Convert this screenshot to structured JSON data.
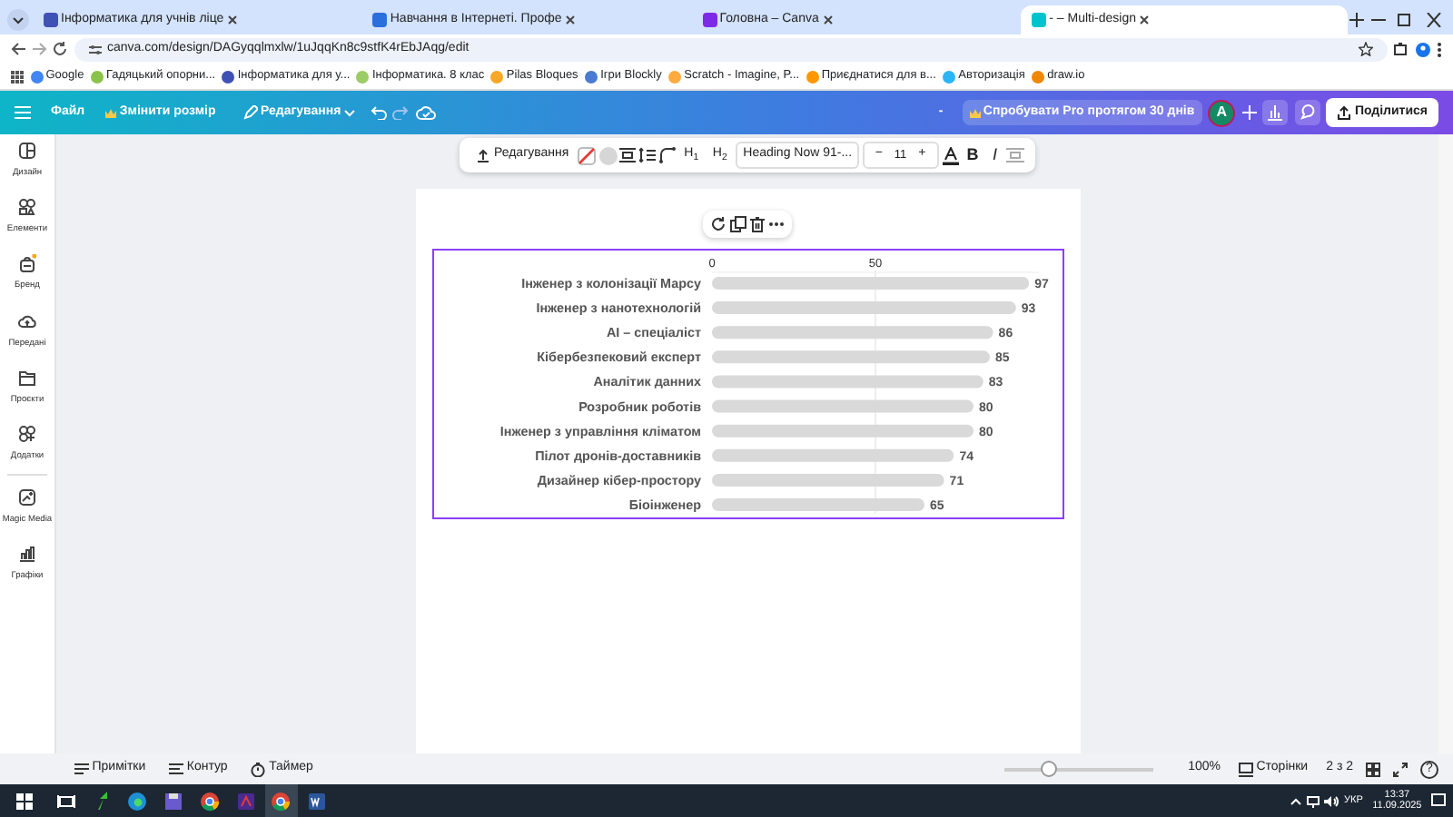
{
  "browser": {
    "tabs": [
      {
        "title": "Інформатика для учнів ліце",
        "selected": false
      },
      {
        "title": "Навчання в Інтернеті. Профе",
        "selected": false
      },
      {
        "title": "Головна – Canva",
        "selected": false
      },
      {
        "title": "- – Multi-design",
        "selected": true
      }
    ],
    "address": "canva.com/design/DAGyqqlmxlw/1uJqqKn8c9stfK4rEbJAqg/edit",
    "bookmarks": [
      {
        "label": "Google",
        "color": "#4285f4"
      },
      {
        "label": "Гадяцький опорни...",
        "color": "#8bc34a"
      },
      {
        "label": "Інформатика для у...",
        "color": "#3f51b5"
      },
      {
        "label": "Інформатика. 8 клас",
        "color": "#9ccc65"
      },
      {
        "label": "Pilas Bloques",
        "color": "#f9a825"
      },
      {
        "label": "Ігри Blockly",
        "color": "#4a7bd0"
      },
      {
        "label": "Scratch - Imagine, P...",
        "color": "#ffab40"
      },
      {
        "label": "Приєднатися для в...",
        "color": "#ff9800"
      },
      {
        "label": "Авторизація",
        "color": "#29b6f6"
      },
      {
        "label": "draw.io",
        "color": "#f08705"
      }
    ]
  },
  "topbar": {
    "file": "Файл",
    "resize": "Змінити розмір",
    "editing": "Редагування",
    "design_title": "-",
    "pro": "Спробувати Pro протягом 30 днів",
    "avatar": "A",
    "share": "Поділитися"
  },
  "sidebar": {
    "items": [
      {
        "label": "Дизайн",
        "kind": "design"
      },
      {
        "label": "Елементи",
        "kind": "elements"
      },
      {
        "label": "Бренд",
        "kind": "brand"
      },
      {
        "label": "Передані",
        "kind": "uploads"
      },
      {
        "label": "Проєкти",
        "kind": "projects"
      },
      {
        "label": "Додатки",
        "kind": "apps"
      },
      {
        "label": "Magic Media",
        "kind": "magic"
      },
      {
        "label": "Графіки",
        "kind": "charts"
      }
    ]
  },
  "text_toolbar": {
    "edit": "Редагування",
    "h1": "H$_{1}$",
    "h2": "H$_{2}$",
    "font": "Heading Now 91-...",
    "minus": "−",
    "size": "11",
    "plus": "+",
    "bold": "B",
    "italic": "I"
  },
  "chart": {
    "chart_data": {
      "type": "bar",
      "orientation": "horizontal",
      "categories": [
        "Інженер з колонізації Марсу",
        "Інженер з нанотехнологій",
        "AI – спеціаліст",
        "Кібербезпековий експерт",
        "Аналітик данних",
        "Розробник роботів",
        "Інженер з управління кліматом",
        "Пілот дронів-доставників",
        "Дизайнер кібер-простору",
        "Біоінженер"
      ],
      "series": [
        {
          "color": "#d9d9d9",
          "values": [
            97,
            93,
            86,
            85,
            83,
            80,
            80,
            74,
            71,
            65
          ]
        }
      ],
      "xlim": [
        0,
        100
      ],
      "xticks": [
        0,
        50
      ],
      "data_labels": true
    }
  },
  "bottom_bar": {
    "notes": "Примітки",
    "outline": "Контур",
    "timer": "Таймер",
    "zoom": {
      "level": 0.3
    },
    "zoom_text": "100%",
    "pages": "Сторінки",
    "page_count": "2 з 2",
    "help": "?"
  },
  "taskbar": {
    "apps": [
      {
        "kind": "start",
        "selected": false
      },
      {
        "kind": "taskview",
        "selected": false
      },
      {
        "kind": "arrow",
        "selected": false
      },
      {
        "kind": "edge",
        "selected": false
      },
      {
        "kind": "disk",
        "selected": false
      },
      {
        "kind": "chrome",
        "selected": false
      },
      {
        "kind": "app",
        "selected": false
      },
      {
        "kind": "chrome",
        "selected": true
      },
      {
        "kind": "word",
        "selected": false
      }
    ],
    "language": "УКР",
    "time": "13:37",
    "date": "11.09.2025"
  }
}
